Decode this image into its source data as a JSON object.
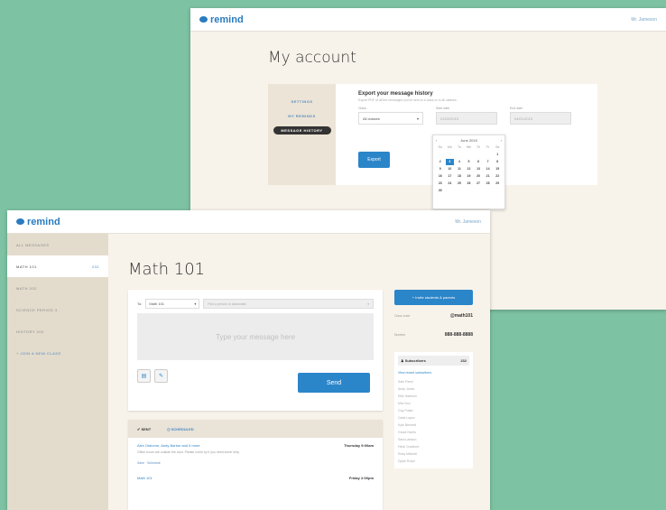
{
  "back_window": {
    "logo": "remind",
    "user": "Mr. Jameson",
    "page_title": "My account",
    "nav": [
      "SETTINGS",
      "MY REMINDS",
      "MESSAGE HISTORY"
    ],
    "export": {
      "title": "Export your message history",
      "subtitle": "Export PDF of all the messages you've sent to a class or to all classes.",
      "class_label": "Class",
      "class_value": "All classes",
      "start_label": "Start date",
      "start_value": "01/02/2015",
      "end_label": "End date",
      "end_value": "04/01/2015",
      "button": "Export"
    },
    "calendar": {
      "month": "June",
      "year": "2015",
      "days_of_week": [
        "Su",
        "Mo",
        "Tu",
        "We",
        "Th",
        "Fr",
        "Sa"
      ],
      "days": [
        "",
        "",
        "",
        "",
        "",
        "",
        "1",
        "2",
        "3",
        "4",
        "5",
        "6",
        "7",
        "8",
        "9",
        "10",
        "11",
        "12",
        "13",
        "14",
        "15",
        "16",
        "17",
        "18",
        "19",
        "20",
        "21",
        "22",
        "23",
        "24",
        "25",
        "26",
        "27",
        "28",
        "29",
        "30",
        ""
      ],
      "selected": "3"
    }
  },
  "front_window": {
    "logo": "remind",
    "user": "Mr. Jameson",
    "sidebar": [
      {
        "label": "ALL MESSAGES",
        "active": false,
        "badge": ""
      },
      {
        "label": "MATH 101",
        "active": true,
        "badge": "232"
      },
      {
        "label": "MATH 202",
        "active": false,
        "badge": ""
      },
      {
        "label": "SCIENCE PERIOD 3",
        "active": false,
        "badge": ""
      },
      {
        "label": "HISTORY 202",
        "active": false,
        "badge": ""
      },
      {
        "label": "+ JOIN A NEW CLASS",
        "active": false,
        "badge": ""
      }
    ],
    "page_title": "Math 101",
    "compose": {
      "to_label": "To:",
      "class": "Math 101",
      "to_placeholder": "Find a person or classmate",
      "message_placeholder": "Type your message here",
      "send": "Send"
    },
    "feed": {
      "tabs": [
        "SENT",
        "SCHEDULED"
      ],
      "messages": [
        {
          "names": "Alex Osborne, Andy Barton and 5 more",
          "time": "Thursday 9:00am",
          "text": "Office hours are outside the door. Please come by if you need some help.",
          "link": "Save · Schedule"
        },
        {
          "names": "Math 101",
          "time": "Friday 2:00pm",
          "text": "",
          "link": ""
        }
      ]
    },
    "side": {
      "intro_button": "Invite students & parents",
      "code_label": "Class code",
      "code_value": "@math101",
      "phone_label": "Number",
      "phone_value": "888-888-8888",
      "subscribers_label": "Subscribers",
      "subscribers_count": "232",
      "view_link": "View recent subscribers",
      "subscribers": [
        "Sam Reed",
        "Andy Jones",
        "Ellie Harrison",
        "Mia Cruz",
        "Guy Potter",
        "Carla Lopez",
        "Kyle Bennett",
        "Grace Harris",
        "Sara Lawson",
        "Heidi Crawford",
        "Ruby Mitchell",
        "Dylan Rossi"
      ]
    }
  }
}
